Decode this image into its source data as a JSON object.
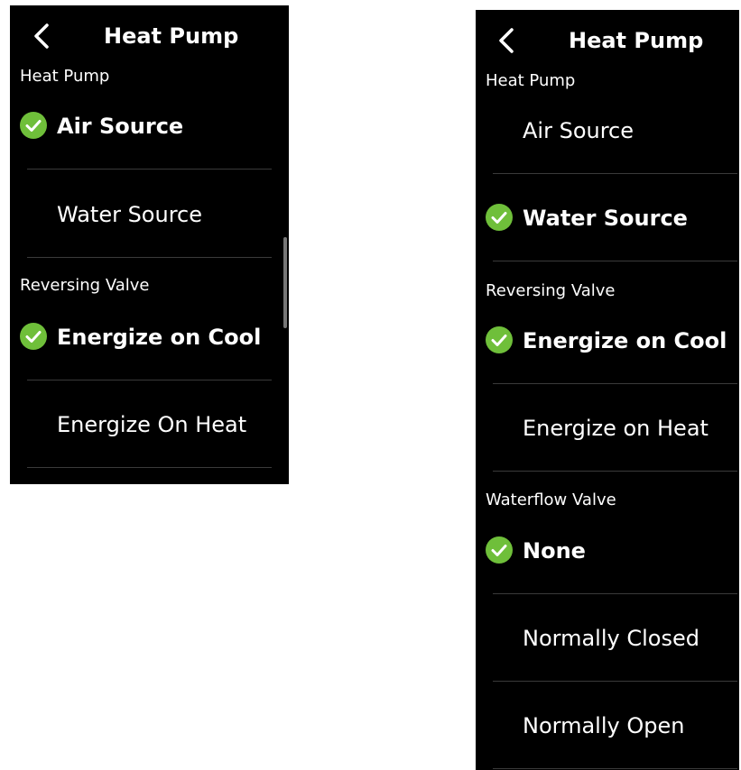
{
  "colors": {
    "background": "#000000",
    "accent": "#6fbf3a",
    "text": "#ffffff",
    "divider": "#3a3a3a"
  },
  "icons": {
    "back": "chevron-left-icon",
    "selected": "check-circle-icon"
  },
  "left_screen": {
    "title": "Heat Pump",
    "sections": [
      {
        "label": "Heat Pump",
        "options": [
          {
            "label": "Air Source",
            "selected": true
          },
          {
            "label": "Water Source",
            "selected": false
          }
        ]
      },
      {
        "label": "Reversing Valve",
        "options": [
          {
            "label": "Energize on Cool",
            "selected": true
          },
          {
            "label": "Energize On Heat",
            "selected": false
          }
        ]
      }
    ]
  },
  "right_screen": {
    "title": "Heat Pump",
    "sections": [
      {
        "label": "Heat Pump",
        "options": [
          {
            "label": "Air Source",
            "selected": false
          },
          {
            "label": "Water Source",
            "selected": true
          }
        ]
      },
      {
        "label": "Reversing Valve",
        "options": [
          {
            "label": "Energize on Cool",
            "selected": true
          },
          {
            "label": "Energize on Heat",
            "selected": false
          }
        ]
      },
      {
        "label": "Waterflow Valve",
        "options": [
          {
            "label": "None",
            "selected": true
          },
          {
            "label": "Normally Closed",
            "selected": false
          },
          {
            "label": "Normally Open",
            "selected": false
          }
        ]
      }
    ]
  }
}
